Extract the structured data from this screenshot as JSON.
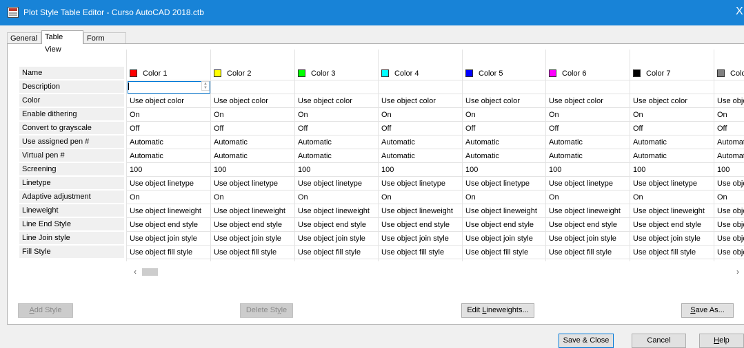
{
  "window": {
    "title": "Plot Style Table Editor - Curso AutoCAD 2018.ctb",
    "close_glyph": "X"
  },
  "tabs": [
    {
      "label": "General",
      "active": false
    },
    {
      "label": "Table View",
      "active": true
    },
    {
      "label": "Form View",
      "active": false
    }
  ],
  "table": {
    "row_labels": [
      "Name",
      "Description",
      "Color",
      "Enable dithering",
      "Convert to grayscale",
      "Use assigned pen #",
      "Virtual pen #",
      "Screening",
      "Linetype",
      "Adaptive adjustment",
      "Lineweight",
      "Line End Style",
      "Line Join style",
      "Fill Style"
    ],
    "columns": [
      {
        "name": "Color 1",
        "swatch": "#ff0000"
      },
      {
        "name": "Color 2",
        "swatch": "#ffff00"
      },
      {
        "name": "Color 3",
        "swatch": "#00ff00"
      },
      {
        "name": "Color 4",
        "swatch": "#00ffff"
      },
      {
        "name": "Color 5",
        "swatch": "#0000ff"
      },
      {
        "name": "Color 6",
        "swatch": "#ff00ff"
      },
      {
        "name": "Color 7",
        "swatch": "#000000"
      },
      {
        "name": "Colo",
        "swatch": "#808080"
      }
    ],
    "values": {
      "description": "",
      "color": [
        "Use object color",
        "Use object color",
        "Use object color",
        "Use object color",
        "Use object color",
        "Use object color",
        "Use object color",
        "Use obje"
      ],
      "enable_dithering": [
        "On",
        "On",
        "On",
        "On",
        "On",
        "On",
        "On",
        "On"
      ],
      "convert_to_grayscale": [
        "Off",
        "Off",
        "Off",
        "Off",
        "Off",
        "Off",
        "Off",
        "Off"
      ],
      "use_assigned_pen": [
        "Automatic",
        "Automatic",
        "Automatic",
        "Automatic",
        "Automatic",
        "Automatic",
        "Automatic",
        "Automat"
      ],
      "virtual_pen": [
        "Automatic",
        "Automatic",
        "Automatic",
        "Automatic",
        "Automatic",
        "Automatic",
        "Automatic",
        "Automat"
      ],
      "screening": [
        "100",
        "100",
        "100",
        "100",
        "100",
        "100",
        "100",
        "100"
      ],
      "linetype": [
        "Use object linetype",
        "Use object linetype",
        "Use object linetype",
        "Use object linetype",
        "Use object linetype",
        "Use object linetype",
        "Use object linetype",
        "Use obje"
      ],
      "adaptive_adjustment": [
        "On",
        "On",
        "On",
        "On",
        "On",
        "On",
        "On",
        "On"
      ],
      "lineweight": [
        "Use object lineweight",
        "Use object lineweight",
        "Use object lineweight",
        "Use object lineweight",
        "Use object lineweight",
        "Use object lineweight",
        "Use object lineweight",
        "Use obje"
      ],
      "line_end_style": [
        "Use object end style",
        "Use object end style",
        "Use object end style",
        "Use object end style",
        "Use object end style",
        "Use object end style",
        "Use object end style",
        "Use obje"
      ],
      "line_join_style": [
        "Use object join style",
        "Use object join style",
        "Use object join style",
        "Use object join style",
        "Use object join style",
        "Use object join style",
        "Use object join style",
        "Use obje"
      ],
      "fill_style": [
        "Use object fill style",
        "Use object fill style",
        "Use object fill style",
        "Use object fill style",
        "Use object fill style",
        "Use object fill style",
        "Use object fill style",
        "Use obje"
      ]
    }
  },
  "buttons": {
    "add_style": {
      "pre": "",
      "u": "A",
      "post": "dd Style"
    },
    "delete_style": {
      "pre": "Delete St",
      "u": "y",
      "post": "le"
    },
    "edit_lineweights": {
      "pre": "Edit ",
      "u": "L",
      "post": "ineweights..."
    },
    "save_as": {
      "pre": "",
      "u": "S",
      "post": "ave As..."
    },
    "save_close": "Save & Close",
    "cancel": "Cancel",
    "help": {
      "pre": "",
      "u": "H",
      "post": "elp"
    }
  }
}
